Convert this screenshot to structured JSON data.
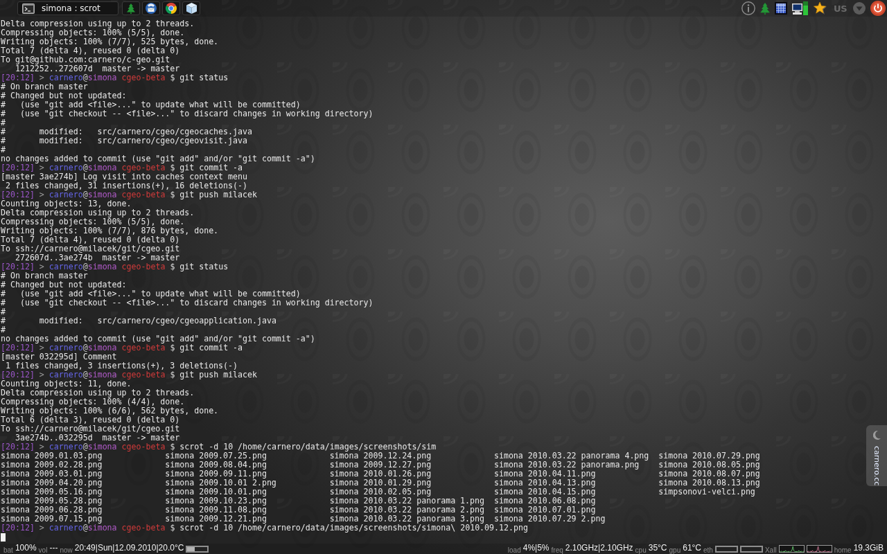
{
  "top_panel": {
    "task": {
      "label": "simona : scrot"
    },
    "keyboard_layout": "US"
  },
  "terminal": {
    "lines": [
      {
        "kind": "output",
        "text": "Delta compression using up to 2 threads."
      },
      {
        "kind": "output",
        "text": "Compressing objects: 100% (5/5), done."
      },
      {
        "kind": "output",
        "text": "Writing objects: 100% (7/7), 525 bytes, done."
      },
      {
        "kind": "output",
        "text": "Total 7 (delta 4), reused 0 (delta 0)"
      },
      {
        "kind": "output",
        "text": "To git@github.com:carnero/c-geo.git"
      },
      {
        "kind": "output",
        "text": "   1212252..272607d  master -> master"
      },
      {
        "kind": "prompt",
        "time": "[20:12]",
        "arrow": ">",
        "user": "carnero",
        "at": "@",
        "host": "simona",
        "dir": "cgeo-beta",
        "sign": "$",
        "command": "git status"
      },
      {
        "kind": "output",
        "text": "# On branch master"
      },
      {
        "kind": "output",
        "text": "# Changed but not updated:"
      },
      {
        "kind": "output",
        "text": "#   (use \"git add <file>...\" to update what will be committed)"
      },
      {
        "kind": "output",
        "text": "#   (use \"git checkout -- <file>...\" to discard changes in working directory)"
      },
      {
        "kind": "output",
        "text": "#"
      },
      {
        "kind": "output",
        "text": "#       modified:   src/carnero/cgeo/cgeocaches.java"
      },
      {
        "kind": "output",
        "text": "#       modified:   src/carnero/cgeo/cgeovisit.java"
      },
      {
        "kind": "output",
        "text": "#"
      },
      {
        "kind": "output",
        "text": "no changes added to commit (use \"git add\" and/or \"git commit -a\")"
      },
      {
        "kind": "prompt",
        "time": "[20:12]",
        "arrow": ">",
        "user": "carnero",
        "at": "@",
        "host": "simona",
        "dir": "cgeo-beta",
        "sign": "$",
        "command": "git commit -a"
      },
      {
        "kind": "output",
        "text": "[master 3ae274b] Log visit into caches context menu"
      },
      {
        "kind": "output",
        "text": " 2 files changed, 31 insertions(+), 16 deletions(-)"
      },
      {
        "kind": "prompt",
        "time": "[20:12]",
        "arrow": ">",
        "user": "carnero",
        "at": "@",
        "host": "simona",
        "dir": "cgeo-beta",
        "sign": "$",
        "command": "git push milacek"
      },
      {
        "kind": "output",
        "text": "Counting objects: 13, done."
      },
      {
        "kind": "output",
        "text": "Delta compression using up to 2 threads."
      },
      {
        "kind": "output",
        "text": "Compressing objects: 100% (5/5), done."
      },
      {
        "kind": "output",
        "text": "Writing objects: 100% (7/7), 876 bytes, done."
      },
      {
        "kind": "output",
        "text": "Total 7 (delta 4), reused 0 (delta 0)"
      },
      {
        "kind": "output",
        "text": "To ssh://carnero@milacek/git/cgeo.git"
      },
      {
        "kind": "output",
        "text": "   272607d..3ae274b  master -> master"
      },
      {
        "kind": "prompt",
        "time": "[20:12]",
        "arrow": ">",
        "user": "carnero",
        "at": "@",
        "host": "simona",
        "dir": "cgeo-beta",
        "sign": "$",
        "command": "git status"
      },
      {
        "kind": "output",
        "text": "# On branch master"
      },
      {
        "kind": "output",
        "text": "# Changed but not updated:"
      },
      {
        "kind": "output",
        "text": "#   (use \"git add <file>...\" to update what will be committed)"
      },
      {
        "kind": "output",
        "text": "#   (use \"git checkout -- <file>...\" to discard changes in working directory)"
      },
      {
        "kind": "output",
        "text": "#"
      },
      {
        "kind": "output",
        "text": "#       modified:   src/carnero/cgeo/cgeoapplication.java"
      },
      {
        "kind": "output",
        "text": "#"
      },
      {
        "kind": "output",
        "text": "no changes added to commit (use \"git add\" and/or \"git commit -a\")"
      },
      {
        "kind": "prompt",
        "time": "[20:12]",
        "arrow": ">",
        "user": "carnero",
        "at": "@",
        "host": "simona",
        "dir": "cgeo-beta",
        "sign": "$",
        "command": "git commit -a"
      },
      {
        "kind": "output",
        "text": "[master 032295d] Comment"
      },
      {
        "kind": "output",
        "text": " 1 files changed, 3 insertions(+), 3 deletions(-)"
      },
      {
        "kind": "prompt",
        "time": "[20:12]",
        "arrow": ">",
        "user": "carnero",
        "at": "@",
        "host": "simona",
        "dir": "cgeo-beta",
        "sign": "$",
        "command": "git push milacek"
      },
      {
        "kind": "output",
        "text": "Counting objects: 11, done."
      },
      {
        "kind": "output",
        "text": "Delta compression using up to 2 threads."
      },
      {
        "kind": "output",
        "text": "Compressing objects: 100% (4/4), done."
      },
      {
        "kind": "output",
        "text": "Writing objects: 100% (6/6), 562 bytes, done."
      },
      {
        "kind": "output",
        "text": "Total 6 (delta 3), reused 0 (delta 0)"
      },
      {
        "kind": "output",
        "text": "To ssh://carnero@milacek/git/cgeo.git"
      },
      {
        "kind": "output",
        "text": "   3ae274b..032295d  master -> master"
      },
      {
        "kind": "prompt",
        "time": "[20:12]",
        "arrow": ">",
        "user": "carnero",
        "at": "@",
        "host": "simona",
        "dir": "cgeo-beta",
        "sign": "$",
        "command": "scrot -d 10 /home/carnero/data/images/screenshots/sim"
      },
      {
        "kind": "listing",
        "files": [
          "simona 2009.01.03.png",
          "simona 2009.07.25.png",
          "simona 2009.12.24.png",
          "simona 2010.03.22 panorama 4.png",
          "simona 2010.07.29.png"
        ]
      },
      {
        "kind": "listing",
        "files": [
          "simona 2009.02.28.png",
          "simona 2009.08.04.png",
          "simona 2009.12.27.png",
          "simona 2010.03.22 panorama.png",
          "simona 2010.08.05.png"
        ]
      },
      {
        "kind": "listing",
        "files": [
          "simona 2009.03.01.png",
          "simona 2009.09.11.png",
          "simona 2010.01.26.png",
          "simona 2010.04.11.png",
          "simona 2010.08.07.png"
        ]
      },
      {
        "kind": "listing",
        "files": [
          "simona 2009.04.20.png",
          "simona 2009.10.01 2.png",
          "simona 2010.01.29.png",
          "simona 2010.04.13.png",
          "simona 2010.08.13.png"
        ]
      },
      {
        "kind": "listing",
        "files": [
          "simona 2009.05.16.png",
          "simona 2009.10.01.png",
          "simona 2010.02.05.png",
          "simona 2010.04.15.png",
          "simpsonovi-velci.png"
        ]
      },
      {
        "kind": "listing",
        "files": [
          "simona 2009.05.28.png",
          "simona 2009.10.23.png",
          "simona 2010.03.22 panorama 1.png",
          "simona 2010.06.08.png"
        ]
      },
      {
        "kind": "listing",
        "files": [
          "simona 2009.06.28.png",
          "simona 2009.11.08.png",
          "simona 2010.03.22 panorama 2.png",
          "simona 2010.07.01.png"
        ]
      },
      {
        "kind": "listing",
        "files": [
          "simona 2009.07.15.png",
          "simona 2009.12.21.png",
          "simona 2010.03.22 panorama 3.png",
          "simona 2010.07.29 2.png"
        ]
      },
      {
        "kind": "prompt",
        "time": "[20:12]",
        "arrow": ">",
        "user": "carnero",
        "at": "@",
        "host": "simona",
        "dir": "cgeo-beta",
        "sign": "$",
        "command": "scrot -d 10 /home/carnero/data/images/screenshots/simona\\ 2010.09.12.png"
      },
      {
        "kind": "cursor"
      }
    ]
  },
  "side_tab": {
    "label": "carnero.cc"
  },
  "bottom_panel": {
    "left": [
      {
        "kind": "stat",
        "label": "bat",
        "value": "100%"
      },
      {
        "kind": "stat",
        "label": "vol",
        "value": "---"
      },
      {
        "kind": "stat",
        "label": "now",
        "value": "20:49|Sun|12.09.2010|20.0°C"
      },
      {
        "kind": "meter",
        "level": 0.35
      }
    ],
    "right": [
      {
        "kind": "stat",
        "label": "load",
        "value": "4%|5%"
      },
      {
        "kind": "stat",
        "label": "freq",
        "value": "2.10GHz|2.10GHz"
      },
      {
        "kind": "stat",
        "label": "cpu",
        "value": "35°C"
      },
      {
        "kind": "stat",
        "label": "gpu",
        "value": "61°C"
      },
      {
        "kind": "label",
        "label": "eth"
      },
      {
        "kind": "empty_meter"
      },
      {
        "kind": "empty_meter"
      },
      {
        "kind": "label",
        "label": "Xall"
      },
      {
        "kind": "graph"
      },
      {
        "kind": "graph"
      },
      {
        "kind": "stat",
        "label": "home",
        "value": "19.3GiB"
      }
    ]
  }
}
